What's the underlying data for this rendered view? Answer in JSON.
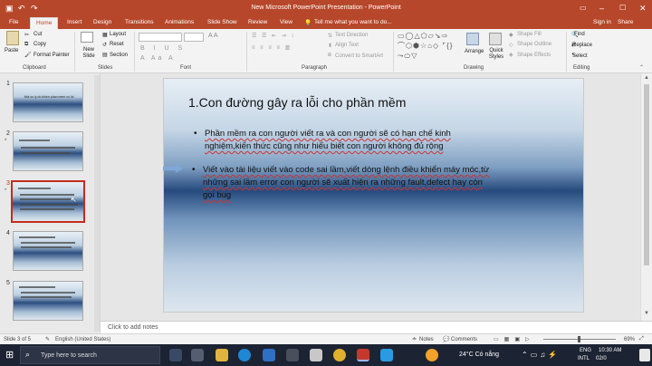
{
  "window": {
    "title": "New Microsoft PowerPoint Presentation - PowerPoint",
    "sign_in": "Sign in",
    "share": "Share"
  },
  "tabs": [
    "File",
    "Home",
    "Insert",
    "Design",
    "Transitions",
    "Animations",
    "Slide Show",
    "Review",
    "View"
  ],
  "tell_me": "Tell me what you want to do...",
  "ribbon": {
    "clipboard": {
      "paste": "Paste",
      "cut": "Cut",
      "copy": "Copy",
      "format_painter": "Format Painter",
      "label": "Clipboard"
    },
    "slides": {
      "new_slide": "New Slide",
      "layout": "Layout",
      "reset": "Reset",
      "section": "Section",
      "label": "Slides"
    },
    "font": {
      "label": "Font"
    },
    "paragraph": {
      "text_direction": "Text Direction",
      "align_text": "Align Text",
      "convert_smartart": "Convert to SmartArt",
      "label": "Paragraph"
    },
    "drawing": {
      "arrange": "Arrange",
      "quick_styles": "Quick Styles",
      "shape_fill": "Shape Fill",
      "shape_outline": "Shape Outline",
      "shape_effects": "Shape Effects",
      "label": "Drawing"
    },
    "editing": {
      "find": "Find",
      "replace": "Replace",
      "select": "Select",
      "label": "Editing"
    }
  },
  "thumbnails": [
    {
      "num": "1",
      "star": "",
      "title": "Mot so ly do khien phan mem co loi"
    },
    {
      "num": "2",
      "star": "*",
      "title": ""
    },
    {
      "num": "3",
      "star": "*",
      "title": ""
    },
    {
      "num": "4",
      "star": "",
      "title": ""
    },
    {
      "num": "5",
      "star": "",
      "title": ""
    }
  ],
  "slide": {
    "title": "1.Con đường gây ra lỗi cho phần mềm",
    "bullets": [
      {
        "lines": [
          "Phần mềm ra con người viết ra và con người sẽ có hạn chế kinh",
          "nghiệm,kiến thức cũng như hiểu biết con người không đủ rộng"
        ]
      },
      {
        "lines": [
          "Viết vào tài liệu viết vào code sai lầm,viết dòng lệnh điều khiển máy móc,từ",
          "những sai lầm error con người sẽ xuất hiện ra những fault,defect hay còn",
          "gọi bug"
        ]
      }
    ]
  },
  "notes_placeholder": "Click to add notes",
  "status": {
    "slide": "Slide 3 of 5",
    "language": "English (United States)",
    "notes": "Notes",
    "comments": "Comments",
    "zoom": "69%"
  },
  "taskbar": {
    "search": "Type here to search",
    "weather": "24°C Có nắng",
    "lang1": "ENG",
    "lang2": "INTL",
    "time": "10:30 AM",
    "date": "02/0"
  },
  "colors": {
    "accent": "#b7472a",
    "taskbar": "#1c2332"
  }
}
